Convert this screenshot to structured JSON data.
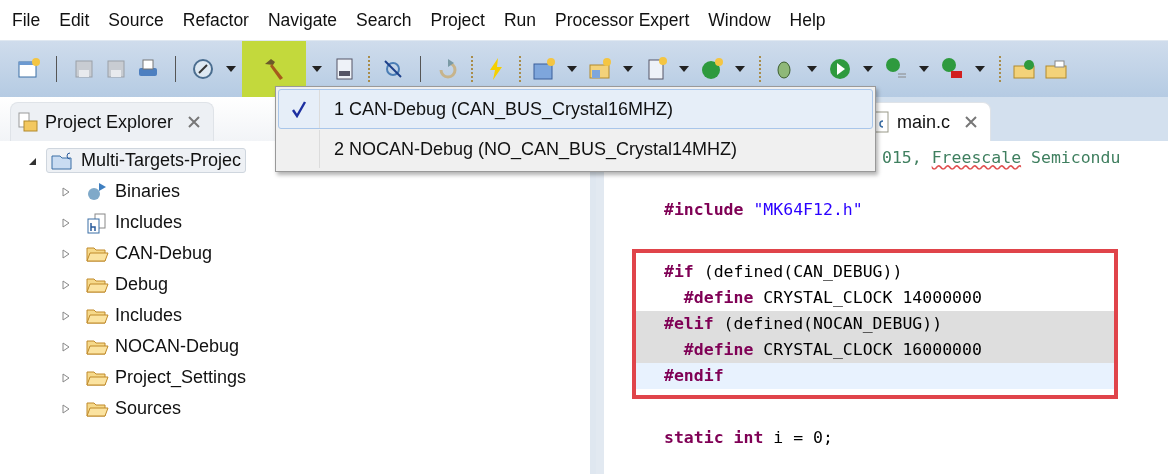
{
  "menu_bar": [
    "File",
    "Edit",
    "Source",
    "Refactor",
    "Navigate",
    "Search",
    "Project",
    "Run",
    "Processor Expert",
    "Window",
    "Help"
  ],
  "toolbar": {
    "build_pressed": true
  },
  "build_menu": [
    {
      "label": "1 CAN-Debug (CAN_BUS_Crystal16MHZ)",
      "checked": true,
      "selected": true
    },
    {
      "label": "2 NOCAN-Debug (NO_CAN_BUS_Crystal14MHZ)",
      "checked": false,
      "selected": false
    }
  ],
  "project_explorer": {
    "title": "Project Explorer",
    "tree": [
      {
        "label": "Multi-Targets-Projec",
        "kind": "project",
        "expanded": true,
        "selected": true,
        "children": [
          {
            "label": "Binaries",
            "kind": "binaries",
            "expanded": false,
            "selected": false
          },
          {
            "label": "Includes",
            "kind": "includes",
            "expanded": false,
            "selected": false
          },
          {
            "label": "CAN-Debug",
            "kind": "folder",
            "expanded": false,
            "selected": false
          },
          {
            "label": "Debug",
            "kind": "folder",
            "expanded": false,
            "selected": false
          },
          {
            "label": "Includes",
            "kind": "folder",
            "expanded": false,
            "selected": false
          },
          {
            "label": "NOCAN-Debug",
            "kind": "folder",
            "expanded": false,
            "selected": false
          },
          {
            "label": "Project_Settings",
            "kind": "folder",
            "expanded": false,
            "selected": false
          },
          {
            "label": "Sources",
            "kind": "folder",
            "expanded": false,
            "selected": false
          }
        ]
      }
    ]
  },
  "editor": {
    "tab": "main.c",
    "code": {
      "before": [
        {
          "tokens": [
            {
              "text": "015, ",
              "kind": "comment"
            },
            {
              "text": "Freescale",
              "kind": "comment-misspelled"
            },
            {
              "text": " Semicondu",
              "kind": "comment"
            }
          ],
          "inactive": false,
          "current": false,
          "offset": true
        },
        {
          "tokens": [
            {
              "text": "#include",
              "kind": "keyword"
            },
            {
              "text": " \"MK64F12.h\"",
              "kind": "string"
            }
          ],
          "inactive": false,
          "current": false
        }
      ],
      "boxed": [
        {
          "tokens": [
            {
              "text": "#if",
              "kind": "keyword"
            },
            {
              "text": " (defined(CAN_DEBUG))",
              "kind": "plain"
            }
          ],
          "inactive": false,
          "current": false
        },
        {
          "tokens": [
            {
              "text": "  #define",
              "kind": "keyword"
            },
            {
              "text": " CRYSTAL_CLOCK 14000000",
              "kind": "plain"
            }
          ],
          "inactive": false,
          "current": false
        },
        {
          "tokens": [
            {
              "text": "#elif",
              "kind": "keyword"
            },
            {
              "text": " (defined(NOCAN_DEBUG))",
              "kind": "plain"
            }
          ],
          "inactive": true,
          "current": false
        },
        {
          "tokens": [
            {
              "text": "  #define",
              "kind": "keyword"
            },
            {
              "text": " CRYSTAL_CLOCK 16000000",
              "kind": "plain"
            }
          ],
          "inactive": true,
          "current": false
        },
        {
          "tokens": [
            {
              "text": "#endif",
              "kind": "keyword"
            }
          ],
          "inactive": false,
          "current": true
        }
      ],
      "after": [
        {
          "tokens": [
            {
              "text": "static",
              "kind": "keyword"
            },
            {
              "text": " int",
              "kind": "keyword"
            },
            {
              "text": " i = 0;",
              "kind": "plain"
            }
          ],
          "inactive": false,
          "current": false
        }
      ]
    }
  }
}
